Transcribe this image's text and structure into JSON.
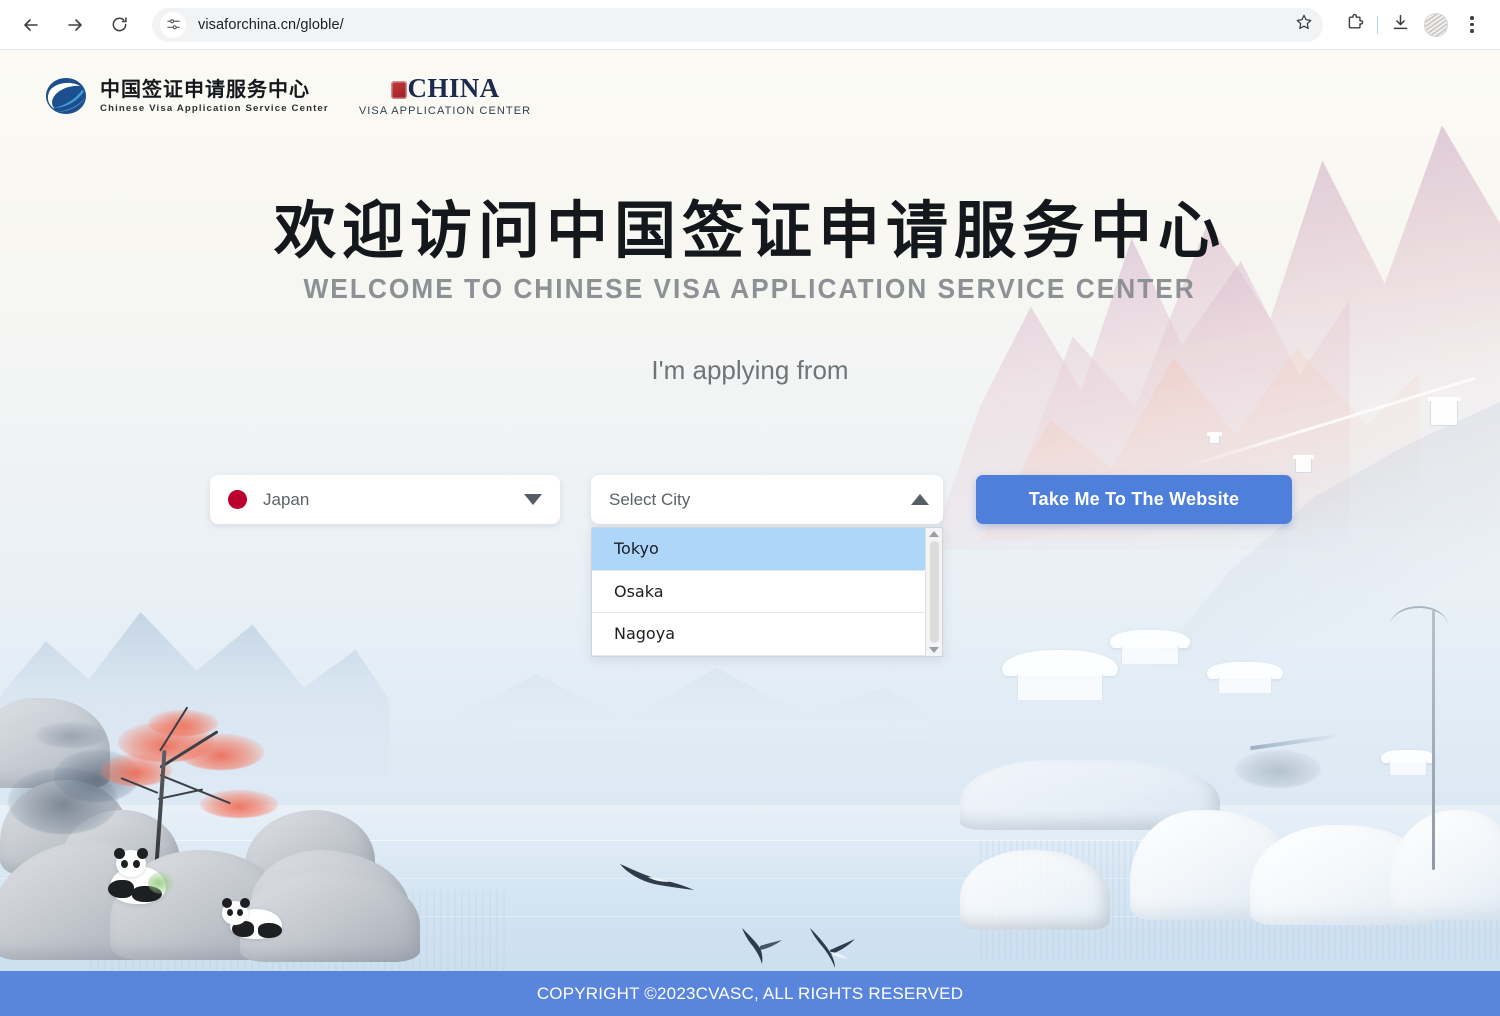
{
  "browser": {
    "url": "visaforchina.cn/globle/",
    "back_icon": "back-arrow-icon",
    "forward_icon": "forward-arrow-icon",
    "reload_icon": "reload-icon",
    "site_info_icon": "site-settings-icon",
    "bookmark_icon": "star-icon",
    "extensions_icon": "puzzle-piece-icon",
    "downloads_icon": "download-icon",
    "profile_icon": "profile-avatar-icon",
    "menu_icon": "kebab-menu-icon"
  },
  "header": {
    "logo_primary": {
      "icon": "globe-swoosh-logo-icon",
      "chinese": "中国签证申请服务中心",
      "english": "Chinese Visa Application Service Center"
    },
    "logo_secondary": {
      "seal_icon": "red-seal-icon",
      "word": "CHINA",
      "subtitle": "VISA APPLICATION CENTER"
    }
  },
  "hero": {
    "title_chinese": "欢迎访问中国签证申请服务中心",
    "title_english": "WELCOME TO CHINESE VISA APPLICATION SERVICE CENTER",
    "prompt": "I'm applying from"
  },
  "form": {
    "country_select": {
      "value": "Japan",
      "flag_icon": "japan-flag-icon",
      "caret_icon": "chevron-down-icon",
      "state": "collapsed"
    },
    "city_select": {
      "placeholder": "Select City",
      "value": "",
      "caret_icon": "chevron-up-icon",
      "state": "expanded",
      "options": [
        "Tokyo",
        "Osaka",
        "Nagoya"
      ],
      "highlighted": "Tokyo",
      "scrollbar": {
        "up_arrow_icon": "scroll-up-arrow-icon",
        "down_arrow_icon": "scroll-down-arrow-icon"
      }
    },
    "submit_button": "Take Me To The Website"
  },
  "footer": {
    "copyright": "COPYRIGHT ©2023CVASC, ALL RIGHTS RESERVED"
  },
  "colors": {
    "accent_blue": "#4d7fdb",
    "footer_blue": "#5a85dd",
    "highlight_blue": "#aed6fb",
    "flag_red": "#bc002d",
    "subtitle_gray": "#8d9196"
  }
}
